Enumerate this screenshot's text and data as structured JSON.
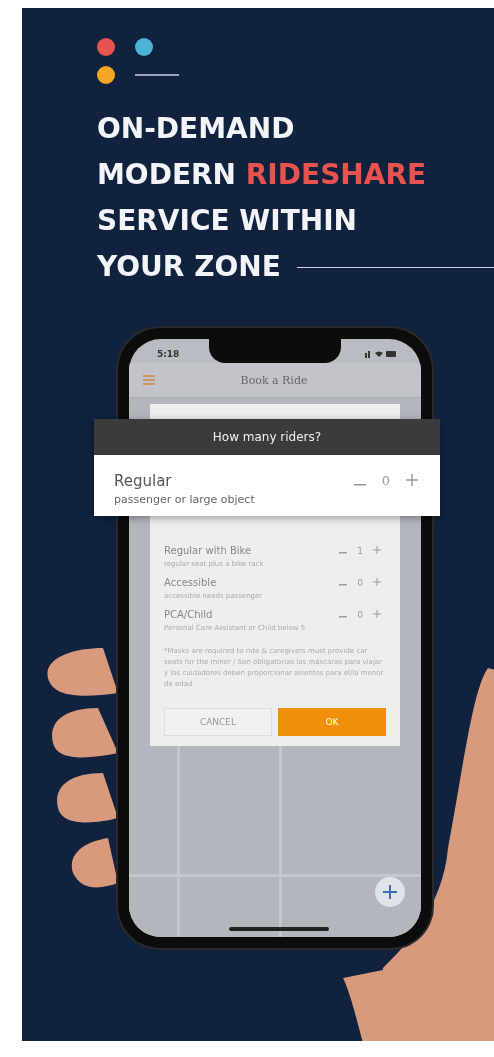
{
  "logo": {
    "dots": [
      {
        "color": "#e8524f"
      },
      {
        "color": "#4ab3d6"
      },
      {
        "color": "#f5a623"
      }
    ]
  },
  "headline": [
    [
      {
        "text": "ON-DEMAND",
        "highlight": false
      }
    ],
    [
      {
        "text": "MODERN ",
        "highlight": false
      },
      {
        "text": "RIDESHARE",
        "highlight": true
      }
    ],
    [
      {
        "text": "SERVICE WITHIN",
        "highlight": false
      }
    ],
    [
      {
        "text": "YOUR ZONE",
        "highlight": false
      }
    ]
  ],
  "phone": {
    "status_time": "5:18",
    "title": "Book a Ride",
    "callout": {
      "title": "How many riders?",
      "rider": {
        "name": "Regular",
        "description": "passenger or large object",
        "count": "0"
      }
    },
    "riders": [
      {
        "name": "Regular with Bike",
        "description": "regular seat plus a bike rack",
        "count": "1"
      },
      {
        "name": "Accessible",
        "description": "accessible needs passenger",
        "count": "0"
      },
      {
        "name": "PCA/Child",
        "description": "Personal Care Assistant or Child below 5",
        "count": "0"
      }
    ],
    "note": "*Masks are required to ride & caregivers must provide car seats for the minor / Son obligatorias las máscaras para viajar y los cuidadores deben proporcionar asientos para el/la menor de edad",
    "buttons": [
      {
        "kind": "secondary",
        "label": "CANCEL"
      },
      {
        "kind": "primary",
        "label": "OK"
      }
    ]
  }
}
